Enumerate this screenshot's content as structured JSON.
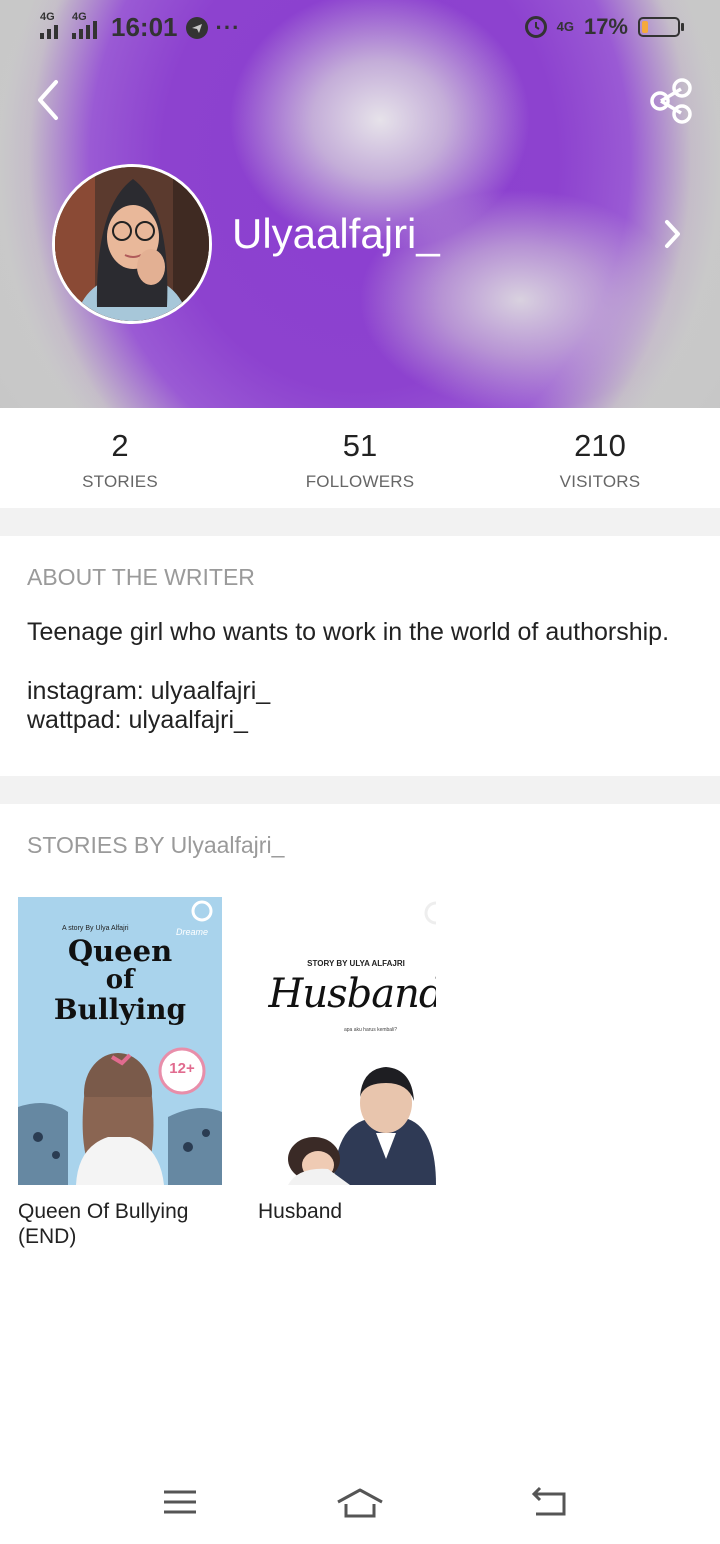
{
  "status_bar": {
    "network_left": "4G",
    "network_right": "4G",
    "time": "16:01",
    "overflow": "···",
    "lte_label": "4G",
    "battery_percent": "17%",
    "battery_level": 0.17,
    "icons": [
      "signal-icon",
      "telegram-icon",
      "alarm-icon",
      "battery-icon"
    ]
  },
  "header": {
    "back_icon": "chevron-left-icon",
    "share_icon": "share-icon",
    "name": "Ulyaalfajri_",
    "chevron_icon": "chevron-right-icon",
    "accent_color": "#8b3fd0"
  },
  "stats": [
    {
      "value": "2",
      "label": "STORIES"
    },
    {
      "value": "51",
      "label": "FOLLOWERS"
    },
    {
      "value": "210",
      "label": "VISITORS"
    }
  ],
  "about": {
    "title": "ABOUT THE WRITER",
    "bio": "Teenage girl who wants to work in the world of authorship.",
    "instagram": "instagram: ulyaalfajri_",
    "wattpad": "wattpad: ulyaalfajri_"
  },
  "stories": {
    "title": "STORIES BY Ulyaalfajri_",
    "items": [
      {
        "title_line1": "Queen Of Bullying",
        "title_line2": "(END)",
        "cover_byline": "A story By Ulya Alfajri",
        "cover_title_1": "Queen",
        "cover_title_2": "of",
        "cover_title_3": "Bullying",
        "cover_badge": "12+",
        "cover_brand": "Dreame"
      },
      {
        "title_line1": "Husband",
        "cover_byline": "STORY BY ULYA ALFAJRI",
        "cover_title": "Husband",
        "cover_tagline": "apa aku harus kembali?"
      }
    ]
  },
  "nav_bar": {
    "icons": [
      "menu-icon",
      "home-icon",
      "back-icon"
    ]
  }
}
